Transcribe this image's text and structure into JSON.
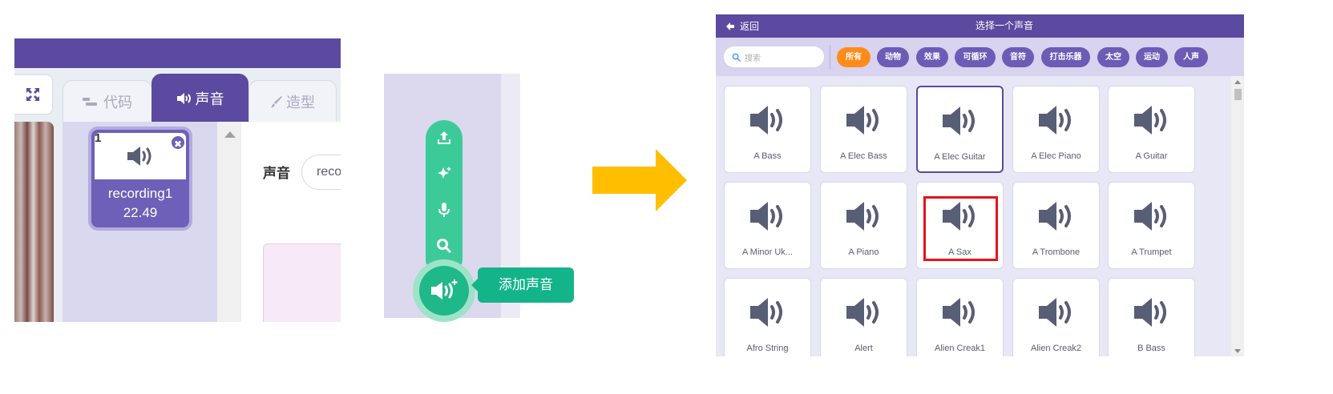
{
  "panel1": {
    "tabs": [
      {
        "label": "代码",
        "icon": "code-icon"
      },
      {
        "label": "声音",
        "icon": "speaker-icon"
      },
      {
        "label": "造型",
        "icon": "brush-icon"
      }
    ],
    "sound_item": {
      "index": "1",
      "name": "recording1",
      "duration": "22.49"
    },
    "sound_field_label": "声音",
    "sound_name_value": "reco"
  },
  "panel2": {
    "menu_icons": [
      "upload-icon",
      "surprise-icon",
      "record-icon",
      "search-icon"
    ],
    "main_icon": "speaker-plus-icon",
    "tooltip": "添加声音"
  },
  "panel3": {
    "back_label": "返回",
    "title": "选择一个声音",
    "search_placeholder": "搜索",
    "categories": [
      "所有",
      "动物",
      "效果",
      "可循环",
      "音符",
      "打击乐器",
      "太空",
      "运动",
      "人声"
    ],
    "active_category": "所有",
    "sounds": [
      "A Bass",
      "A Elec Bass",
      "A Elec Guitar",
      "A Elec Piano",
      "A Guitar",
      "A Minor Uk...",
      "A Piano",
      "A Sax",
      "A Trombone",
      "A Trumpet",
      "Afro String",
      "Alert",
      "Alien Creak1",
      "Alien Creak2",
      "B Bass"
    ],
    "selected_sound": "A Elec Guitar",
    "highlighted_sound": "A Sax"
  },
  "colors": {
    "purple": "#5b4aa0",
    "green": "#3ccb98",
    "orange_chip": "#ff8c1a",
    "arrow": "#ffbf00",
    "highlight": "#e8131a"
  }
}
